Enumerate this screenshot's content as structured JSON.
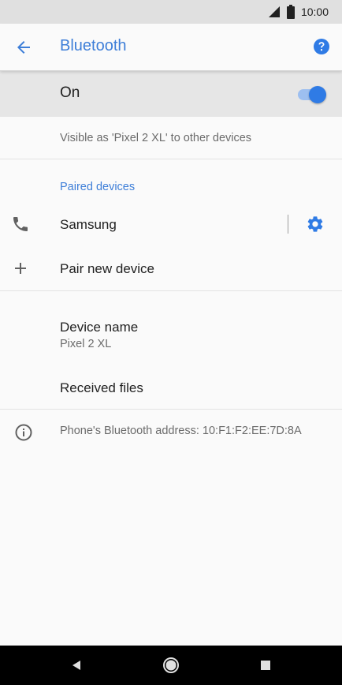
{
  "status_bar": {
    "time": "10:00",
    "icons": [
      "signal-icon",
      "battery-icon"
    ]
  },
  "app_bar": {
    "title": "Bluetooth",
    "back_icon": "arrow-back-icon",
    "help_icon": "help-icon",
    "accent_color": "#3d7ed8"
  },
  "master_switch": {
    "label": "On",
    "checked": true
  },
  "visible_as": "Visible as 'Pixel 2 XL' to other devices",
  "paired_devices": {
    "header": "Paired devices",
    "items": [
      {
        "name": "Samsung",
        "icon": "phone-icon",
        "settings_icon": "gear-icon"
      }
    ]
  },
  "pair_new": {
    "label": "Pair new device",
    "icon": "plus-icon"
  },
  "device_name": {
    "label": "Device name",
    "value": "Pixel 2 XL"
  },
  "received_files": {
    "label": "Received files"
  },
  "address_info": {
    "text": "Phone's Bluetooth address: 10:F1:F2:EE:7D:8A",
    "icon": "info-icon"
  },
  "nav_bar": {
    "buttons": [
      "back-triangle-icon",
      "home-circle-icon",
      "recents-square-icon"
    ]
  }
}
